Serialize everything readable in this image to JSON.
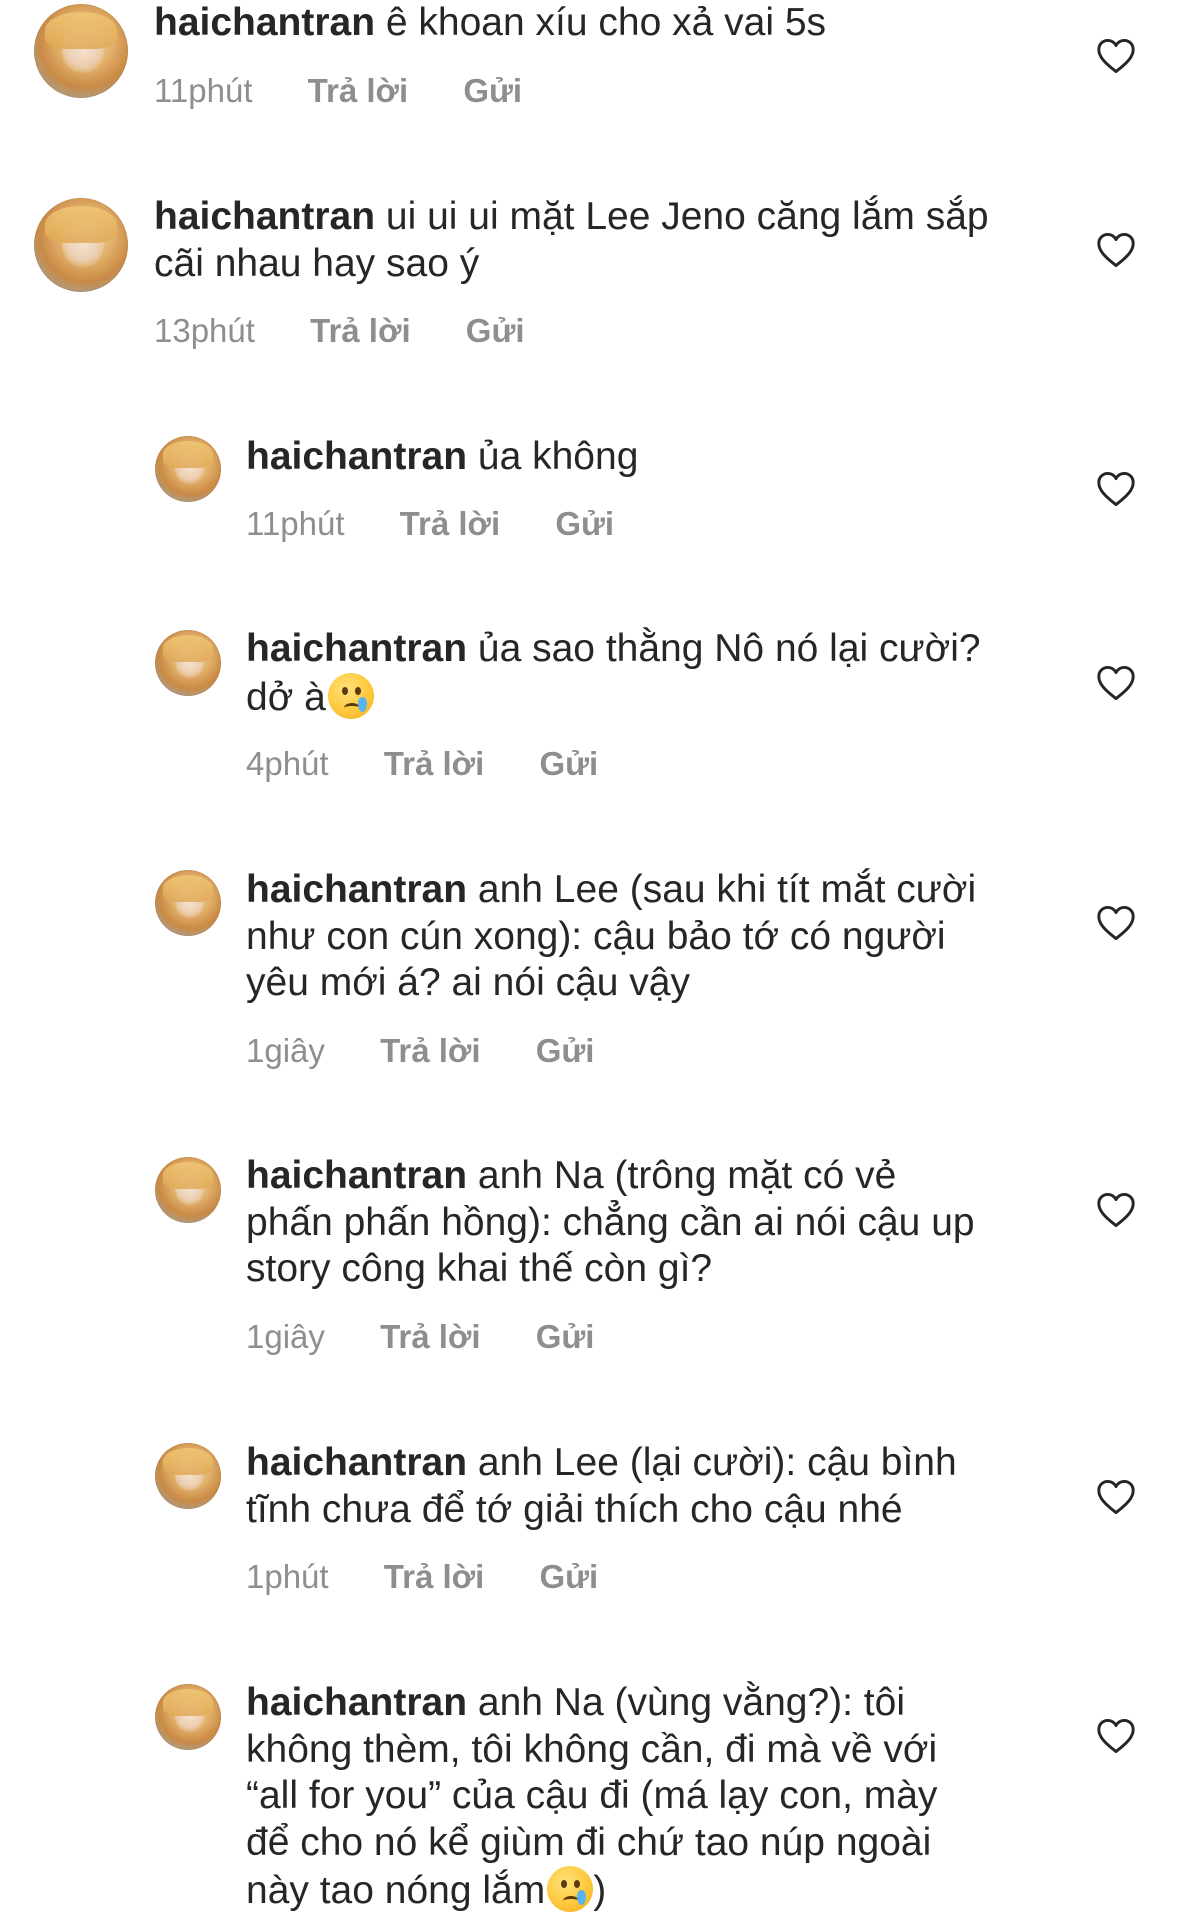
{
  "comments": [
    {
      "username": "haichantran",
      "text": "ê khoan xíu cho xả vai 5s",
      "time": "11phút",
      "reply_label": "Trả lời",
      "send_label": "Gửi"
    },
    {
      "username": "haichantran",
      "text_lines": [
        "ui ui ui mặt Lee Jeno căng lắm sắp",
        "cãi nhau hay sao ý"
      ],
      "time": "13phút",
      "reply_label": "Trả lời",
      "send_label": "Gửi"
    }
  ],
  "replies": [
    {
      "username": "haichantran",
      "text": "ủa không",
      "time": "11phút",
      "reply_label": "Trả lời",
      "send_label": "Gửi"
    },
    {
      "username": "haichantran",
      "text_lines": [
        "ủa sao thằng Nô nó lại cười?",
        "dở à"
      ],
      "emoji": "sad-tear-emoji",
      "time": "4phút",
      "reply_label": "Trả lời",
      "send_label": "Gửi"
    },
    {
      "username": "haichantran",
      "text_lines": [
        "anh Lee (sau khi tít mắt cười",
        "như con cún xong): cậu bảo tớ có người",
        "yêu mới á? ai nói cậu vậy"
      ],
      "time": "1giây",
      "reply_label": "Trả lời",
      "send_label": "Gửi"
    },
    {
      "username": "haichantran",
      "text_lines": [
        "anh Na (trông mặt có vẻ",
        "phấn phấn hồng): chẳng cần ai nói cậu up",
        "story công khai thế còn gì?"
      ],
      "time": "1giây",
      "reply_label": "Trả lời",
      "send_label": "Gửi"
    },
    {
      "username": "haichantran",
      "text_lines": [
        "anh Lee (lại cười): cậu bình",
        "tĩnh chưa để tớ giải thích cho cậu nhé"
      ],
      "time": "1phút",
      "reply_label": "Trả lời",
      "send_label": "Gửi"
    },
    {
      "username": "haichantran",
      "text_lines": [
        "anh Na (vùng vằng?): tôi",
        "không thèm, tôi không cần, đi mà   về với",
        "“all for you” của cậu đi (má lạy con, mày",
        "để cho nó kể giùm đi chứ tao núp ngoài",
        "này tao nóng lắm"
      ],
      "text_tail": ")",
      "emoji": "sad-tear-emoji",
      "time": "",
      "reply_label": "",
      "send_label": ""
    }
  ],
  "icons": {
    "like": "heart-outline-icon"
  },
  "colors": {
    "text": "#262626",
    "meta": "#8e8e8e",
    "background": "#ffffff"
  }
}
